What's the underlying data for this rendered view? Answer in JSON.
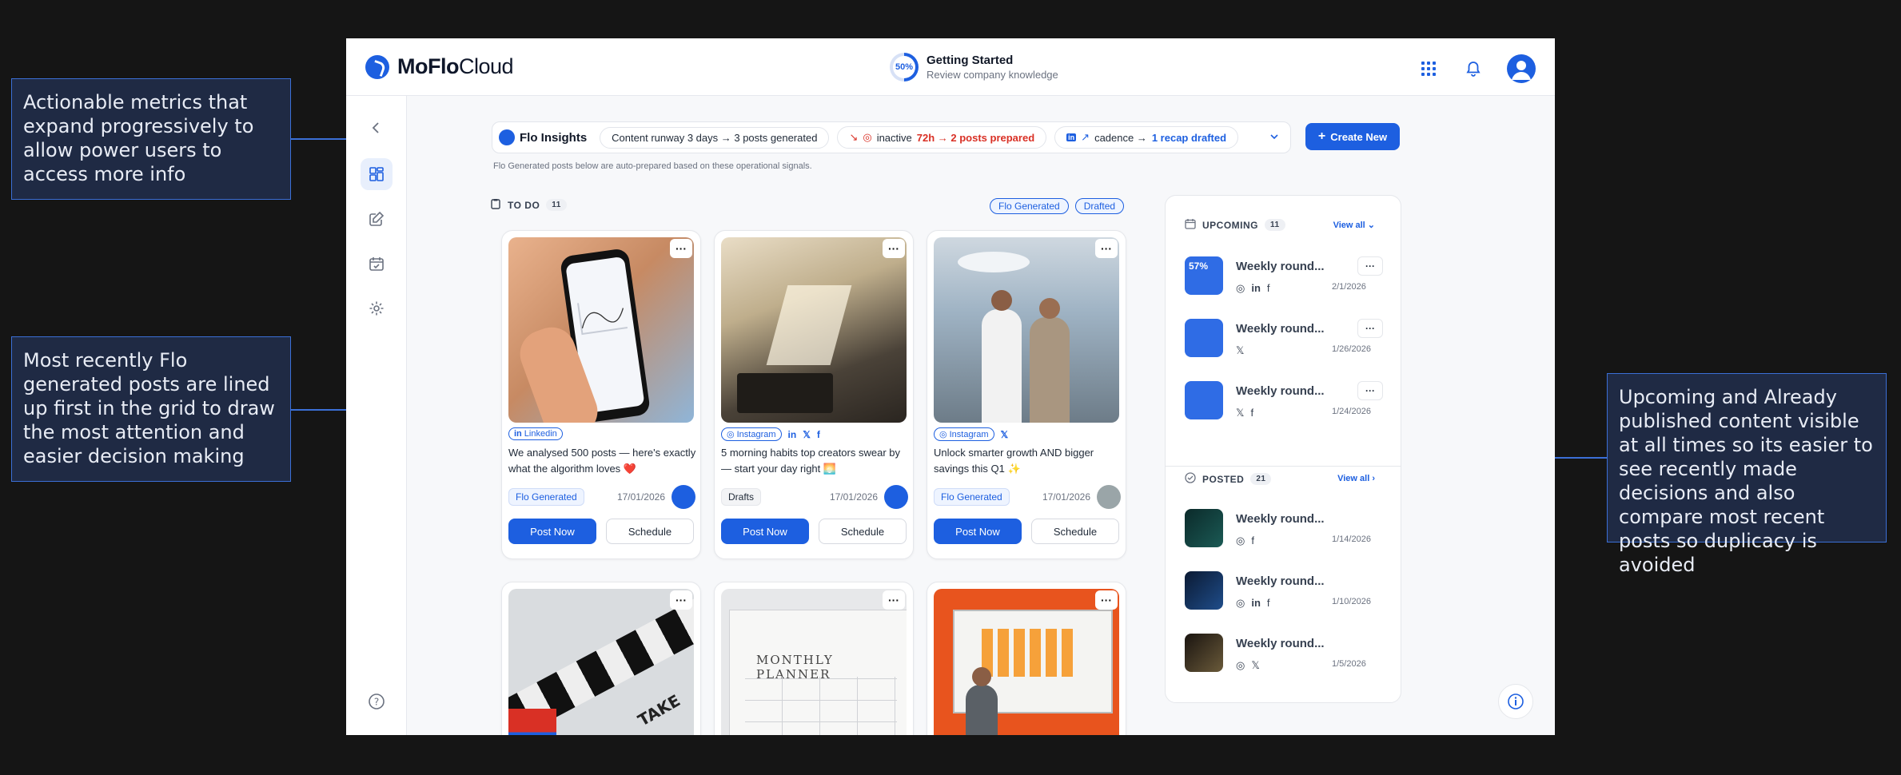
{
  "annotations": {
    "metrics": "Actionable metrics that expand progressively to allow power users to access more info",
    "grid": "Most recently Flo generated posts are lined up first in the grid to draw the most attention and easier decision making",
    "upcoming": "Upcoming and Already published content visible at all times so its easier to see recently made decisions and also compare most recent posts so duplicacy is avoided"
  },
  "app": {
    "brand_bold": "MoFlo",
    "brand_light": "Cloud",
    "progress": {
      "percent_label": "50%",
      "percent_value": 50,
      "title": "Getting Started",
      "subtitle": "Review company knowledge"
    },
    "icons": {
      "apps": "grid-icon",
      "notifications": "bell-icon",
      "profile": "user-avatar-icon"
    }
  },
  "sidebar": {
    "items": [
      {
        "name": "collapse",
        "icon": "chevron-left-icon"
      },
      {
        "name": "dashboard",
        "icon": "dashboard-icon",
        "active": true
      },
      {
        "name": "compose",
        "icon": "edit-icon"
      },
      {
        "name": "calendar",
        "icon": "calendar-icon"
      },
      {
        "name": "settings",
        "icon": "gear-icon"
      },
      {
        "name": "help",
        "icon": "help-icon"
      }
    ]
  },
  "insights": {
    "title": "Flo Insights",
    "chip1": "Content runway 3 days → 3 posts generated",
    "chip2_pre": "inactive",
    "chip2_hl": "72h → 2 posts prepared",
    "chip3_pre": "cadence →",
    "chip3_hl": "1 recap drafted",
    "create": "Create New",
    "note": "Flo Generated posts below are auto-prepared based on these operational signals."
  },
  "todo": {
    "label": "TO DO",
    "count": "11",
    "filters": [
      "Flo Generated",
      "Drafted"
    ]
  },
  "cards": [
    {
      "platform_label": "Linkedin",
      "text": "We analysed 500 posts — here's exactly what the algorithm loves ❤️",
      "status": "Flo Generated",
      "date": "17/01/2026",
      "post": "Post Now",
      "schedule": "Schedule"
    },
    {
      "platform_label": "Instagram",
      "text": "5 morning habits top creators swear by — start your day right 🌅",
      "status": "Drafts",
      "date": "17/01/2026",
      "post": "Post Now",
      "schedule": "Schedule"
    },
    {
      "platform_label": "Instagram",
      "text": "Unlock smarter growth AND bigger savings this Q1 ✨",
      "status": "Flo Generated",
      "date": "17/01/2026",
      "post": "Post Now",
      "schedule": "Schedule"
    }
  ],
  "more_label": "···",
  "panel": {
    "upcoming_label": "UPCOMING",
    "upcoming_count": "11",
    "posted_label": "POSTED",
    "posted_count": "21",
    "view_all": "View all",
    "upcoming": [
      {
        "title": "Weekly round...",
        "date": "2/1/2026",
        "thumb_text": "57%"
      },
      {
        "title": "Weekly round...",
        "date": "1/26/2026"
      },
      {
        "title": "Weekly round...",
        "date": "1/24/2026"
      }
    ],
    "posted": [
      {
        "title": "Weekly round...",
        "date": "1/14/2026"
      },
      {
        "title": "Weekly round...",
        "date": "1/10/2026"
      },
      {
        "title": "Weekly round...",
        "date": "1/5/2026"
      }
    ]
  },
  "grid_row2": {
    "planner_text": "MONTHLY PLANNER",
    "clapper_text": "TAKE"
  }
}
